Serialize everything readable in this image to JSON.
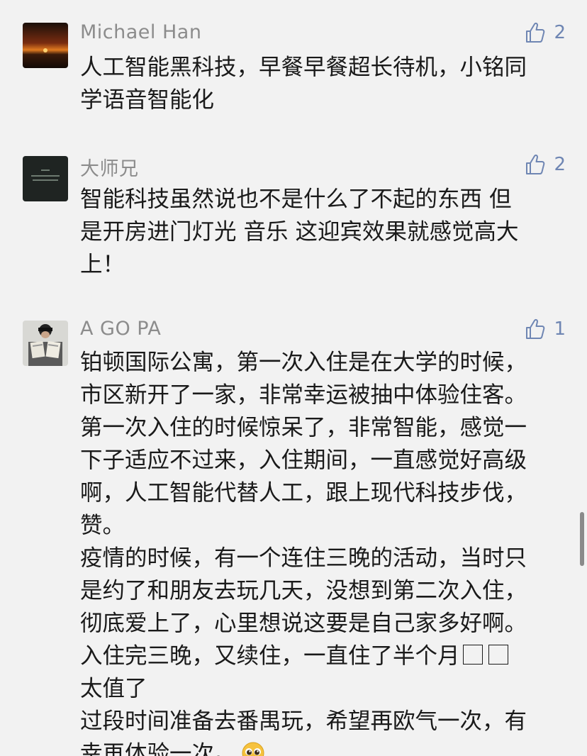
{
  "comments": [
    {
      "author": "Michael Han",
      "likes": "2",
      "avatar_icon": "sunset-avatar-icon",
      "lines": [
        "人工智能黑科技，早餐早餐超长待机，小铭同",
        "学语音智能化"
      ]
    },
    {
      "author": "大师兄",
      "likes": "2",
      "avatar_icon": "dark-text-avatar-icon",
      "lines": [
        "智能科技虽然说也不是什么了不起的东西 但",
        "是开房进门灯光 音乐 这迎宾效果就感觉高大",
        "上！"
      ]
    },
    {
      "author": "A GO PA",
      "likes": "1",
      "avatar_icon": "person-reading-avatar-icon",
      "lines": [
        "铂顿国际公寓，第一次入住是在大学的时候，",
        "市区新开了一家，非常幸运被抽中体验住客。",
        "第一次入住的时候惊呆了，非常智能，感觉一",
        "下子适应不过来，入住期间，一直感觉好高级",
        "啊，人工智能代替人工，跟上现代科技步伐，",
        "赞。",
        "疫情的时候，有一个连住三晚的活动，当时只",
        "是约了和朋友去玩几天，没想到第二次入住，",
        "彻底爱上了，心里想说这要是自己家多好啊。",
        "入住完三晚，又续住，一直住了半个月",
        "太值了",
        "过段时间准备去番禺玩，希望再欧气一次，有",
        "幸再体验一次。"
      ]
    }
  ],
  "colors": {
    "like": "#6f86b3",
    "nick": "#8c8c8c",
    "text": "#1a1a1a",
    "background": "#f2f2f2"
  }
}
